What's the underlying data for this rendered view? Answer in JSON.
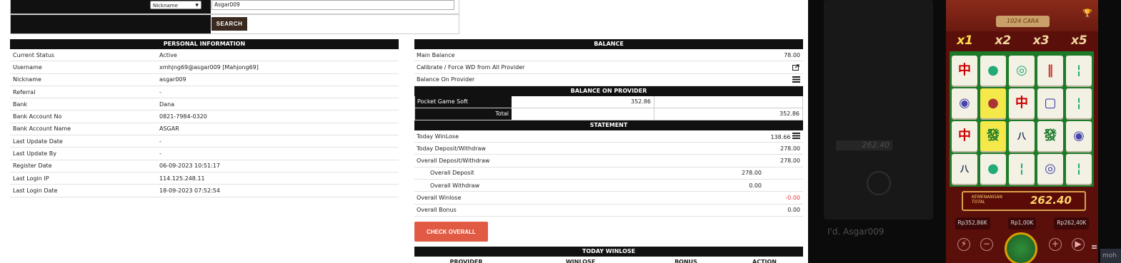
{
  "search": {
    "select_value": "Nickname",
    "input_value": "Asgar009",
    "button_label": "SEARCH"
  },
  "personal": {
    "header": "PERSONAL INFORMATION",
    "rows": [
      {
        "k": "Current Status",
        "v": "Active"
      },
      {
        "k": "Username",
        "v": "xmhjng69@asgar009  [Mahjong69]"
      },
      {
        "k": "Nickname",
        "v": "asgar009"
      },
      {
        "k": "Referral",
        "v": "-"
      },
      {
        "k": "Bank",
        "v": "Dana"
      },
      {
        "k": "Bank Account No",
        "v": "0821-7984-0320"
      },
      {
        "k": "Bank Account Name",
        "v": "ASGAR"
      },
      {
        "k": "Last Update Date",
        "v": "-"
      },
      {
        "k": "Last Update By",
        "v": "-"
      },
      {
        "k": "Register Date",
        "v": "06-09-2023 10:51:17"
      },
      {
        "k": "Last Login IP",
        "v": "114.125.248.11"
      },
      {
        "k": "Last Login Date",
        "v": "18-09-2023 07:52:54"
      }
    ]
  },
  "balance": {
    "header": "BALANCE",
    "main_label": "Main Balance",
    "main_value": "78.00",
    "calibrate_label": "Calibrate / Force WD from All Provider",
    "on_provider_label": "Balance On Provider",
    "provider_header": "BALANCE ON PROVIDER",
    "provider_name": "Pocket Game Soft",
    "provider_value": "352.86",
    "total_label": "Total",
    "total_value": "352.86"
  },
  "statement": {
    "header": "STATEMENT",
    "today_winlose_label": "Today WinLose",
    "today_winlose_value": "138.66",
    "today_dw_label": "Today Deposit/Withdraw",
    "today_dw_value": "278.00",
    "overall_dw_label": "Overall Deposit/Withdraw",
    "overall_dw_value": "278.00",
    "overall_deposit_label": "Overall Deposit",
    "overall_deposit_value": "278.00",
    "overall_withdraw_label": "Overall Withdraw",
    "overall_withdraw_value": "0.00",
    "overall_winlose_label": "Overall Winlose",
    "overall_winlose_value": "-0.00",
    "overall_bonus_label": "Overall Bonus",
    "overall_bonus_value": "0.00",
    "check_button": "CHECK OVERALL"
  },
  "today_winlose": {
    "header": "TODAY WINLOSE",
    "columns": [
      "PROVIDER",
      "WINLOSE",
      "BONUS",
      "ACTION"
    ]
  },
  "game": {
    "title": "1024 CARA",
    "multipliers": [
      "x1",
      "x2",
      "x3",
      "x5"
    ],
    "win_label_1": "KEMENANGAN",
    "win_label_2": "TOTAL",
    "win_value": "262.40",
    "stat_balance": "Rp352,86K",
    "stat_bet": "Rp1,00K",
    "stat_win": "Rp262,40K",
    "turbo_label": "TURBO",
    "auto_label": "AUTO"
  },
  "ghost": {
    "win_value": "262.40",
    "name": "I'd. Asgar009"
  },
  "taskbar_text": "moh",
  "colors": {
    "accent": "#e15a43",
    "search_btn": "#3a2a1f",
    "header_bg": "#111111",
    "negative": "#ee3333"
  }
}
